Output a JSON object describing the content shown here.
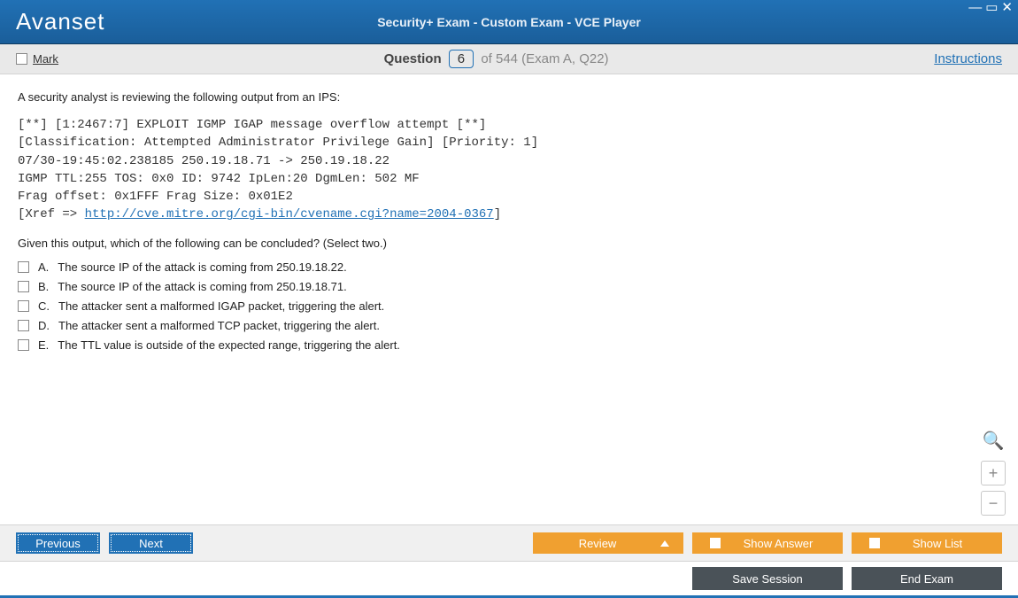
{
  "header": {
    "logo": "Avanset",
    "title": "Security+ Exam - Custom Exam - VCE Player"
  },
  "subheader": {
    "mark_label": "Mark",
    "question_word": "Question",
    "question_number": "6",
    "question_tail": "of 544 (Exam A, Q22)",
    "instructions": "Instructions"
  },
  "question": {
    "intro": "A security analyst is reviewing the following output from an IPS:",
    "ips_line1": "[**] [1:2467:7] EXPLOIT IGMP IGAP message overflow attempt [**]",
    "ips_line2": "[Classification: Attempted Administrator Privilege Gain] [Priority: 1]",
    "ips_line3": "07/30-19:45:02.238185 250.19.18.71 -> 250.19.18.22",
    "ips_line4": "IGMP TTL:255 TOS: 0x0 ID: 9742 IpLen:20 DgmLen: 502 MF",
    "ips_line5": "Frag offset: 0x1FFF Frag Size: 0x01E2",
    "ips_xref_pre": "[Xref => ",
    "ips_xref_link": "http://cve.mitre.org/cgi-bin/cvename.cgi?name=2004-0367",
    "ips_xref_post": "]",
    "prompt": "Given this output, which of the following can be concluded? (Select two.)",
    "answers": [
      {
        "letter": "A.",
        "text": "The source IP of the attack is coming from 250.19.18.22."
      },
      {
        "letter": "B.",
        "text": "The source IP of the attack is coming from 250.19.18.71."
      },
      {
        "letter": "C.",
        "text": "The attacker sent a malformed IGAP packet, triggering the alert."
      },
      {
        "letter": "D.",
        "text": "The attacker sent a malformed TCP packet, triggering the alert."
      },
      {
        "letter": "E.",
        "text": "The TTL value is outside of the expected range, triggering the alert."
      }
    ]
  },
  "footer": {
    "previous": "Previous",
    "next": "Next",
    "review": "Review",
    "show_answer": "Show Answer",
    "show_list": "Show List",
    "save_session": "Save Session",
    "end_exam": "End Exam"
  }
}
